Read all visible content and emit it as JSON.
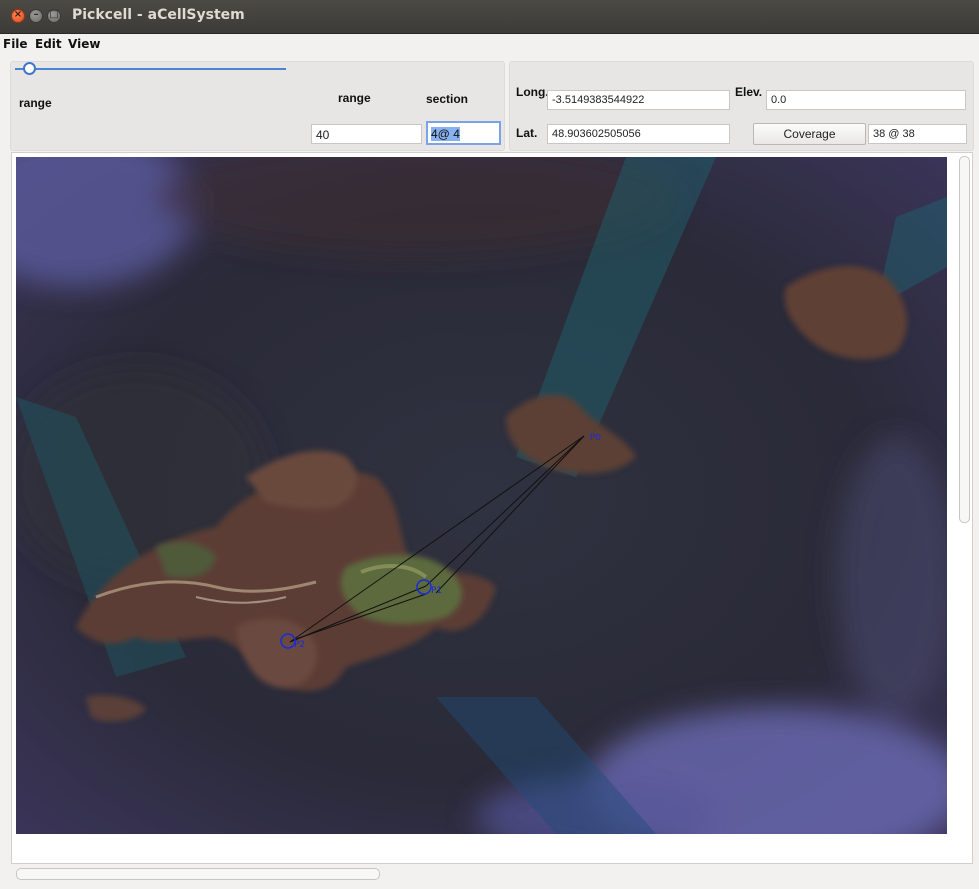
{
  "window": {
    "title": "Pickcell - aCellSystem",
    "close_glyph": "×",
    "min_glyph": "–",
    "max_glyph": "□"
  },
  "menu": {
    "items": [
      "File",
      "Edit",
      "View"
    ]
  },
  "controls": {
    "range_slider_label": "range",
    "range_label": "range",
    "section_label": "section",
    "range_value": "40",
    "section_value": "4@ 4",
    "slider_level": 0.05
  },
  "coords": {
    "long_label": "Long.",
    "long_value": "-3.5149383544922",
    "lat_label": "Lat.",
    "lat_value": "48.903602505056",
    "elev_label": "Elev.",
    "elev_value": "0.0",
    "coverage_button": "Coverage",
    "coverage_value": "38 @ 38"
  },
  "map": {
    "points": [
      {
        "label": "P0"
      },
      {
        "label": "P1"
      },
      {
        "label": "P2"
      }
    ],
    "marker_color": "#1a2bd8",
    "line_color": "#111111"
  },
  "colors": {
    "slider_accent": "#4a84d6",
    "focus_border": "#7aa3e8",
    "titlebar": "#3c3b37"
  }
}
